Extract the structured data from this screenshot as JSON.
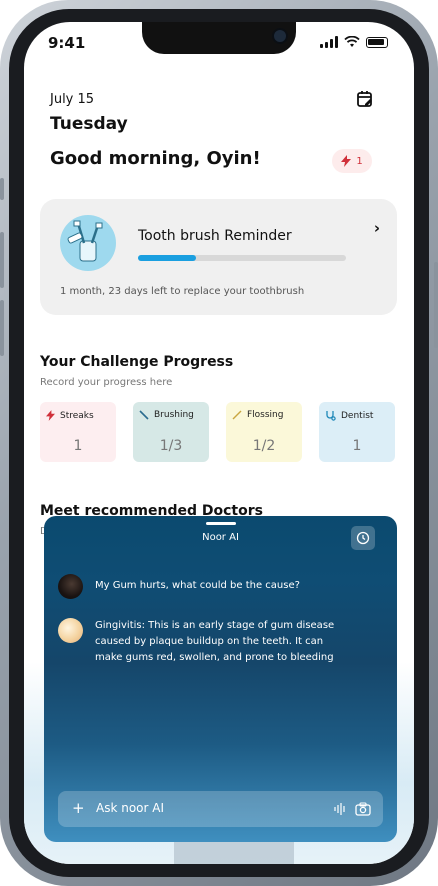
{
  "status_bar": {
    "time": "9:41"
  },
  "header": {
    "date": "July 15",
    "weekday": "Tuesday",
    "greeting": "Good morning, Oyin!",
    "streak_count": "1"
  },
  "reminder": {
    "title": "Tooth brush Reminder",
    "progress": 0.28,
    "subtitle": "1 month, 23 days left to replace your toothbrush"
  },
  "challenge": {
    "title": "Your Challenge Progress",
    "subtitle": "Record your progress here",
    "cards": [
      {
        "label": "Streaks",
        "value": "1",
        "bg": "#fdeef0",
        "icon": "lightning-icon"
      },
      {
        "label": "Brushing",
        "value": "1/3",
        "bg": "#d6e8e6",
        "icon": "toothbrush-icon"
      },
      {
        "label": "Flossing",
        "value": "1/2",
        "bg": "#fbf8d9",
        "icon": "floss-icon"
      },
      {
        "label": "Dentist",
        "value": "1",
        "bg": "#dceef7",
        "icon": "stethoscope-icon"
      }
    ]
  },
  "doctors": {
    "title": "Meet recommended Doctors",
    "subtitle_partial": "D"
  },
  "ai": {
    "title": "Noor AI",
    "messages": [
      {
        "from": "user",
        "text": "My Gum hurts, what could be the cause?"
      },
      {
        "from": "ai",
        "text": "Gingivitis: This is an early stage of gum disease caused by plaque buildup on the teeth. It can make gums red, swollen, and prone to bleeding"
      }
    ],
    "input_placeholder": "Ask noor AI"
  },
  "colors": {
    "accent": "#1a9fe0",
    "streak_red": "#d0303a"
  }
}
